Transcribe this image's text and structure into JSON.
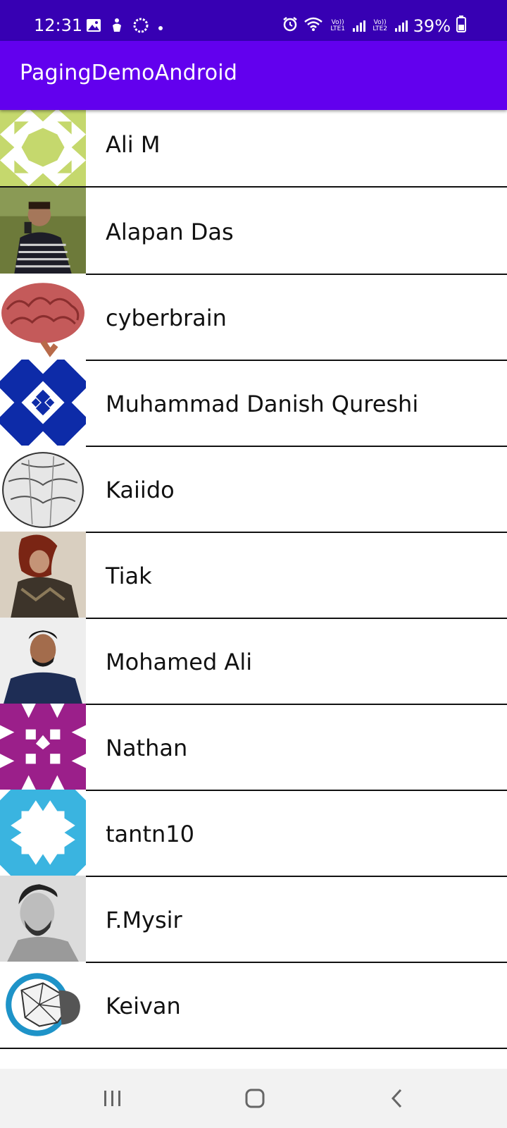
{
  "status_bar": {
    "time": "12:31",
    "net1": "Vo)) LTE1",
    "net2": "Vo)) LTE2",
    "battery": "39%"
  },
  "app_bar": {
    "title": "PagingDemoAndroid"
  },
  "users": [
    {
      "name": "Ali M",
      "avatar": "identicon-green"
    },
    {
      "name": "Alapan Das",
      "avatar": "photo-man-selfie"
    },
    {
      "name": "cyberbrain",
      "avatar": "brain-image"
    },
    {
      "name": "Muhammad Danish Qureshi",
      "avatar": "identicon-blue"
    },
    {
      "name": "Kaiido",
      "avatar": "sketch-circle"
    },
    {
      "name": "Tiak",
      "avatar": "fantasy-warrior"
    },
    {
      "name": "Mohamed Ali",
      "avatar": "photo-man-portrait"
    },
    {
      "name": "Nathan",
      "avatar": "identicon-purple"
    },
    {
      "name": "tantn10",
      "avatar": "identicon-cyan"
    },
    {
      "name": "F.Mysir",
      "avatar": "photo-man-bw"
    },
    {
      "name": "Keivan",
      "avatar": "brain-logo"
    }
  ],
  "colors": {
    "status_bar": "#3700b3",
    "app_bar": "#6200ee",
    "divider": "#111111",
    "nav_bar": "#f2f2f2"
  }
}
